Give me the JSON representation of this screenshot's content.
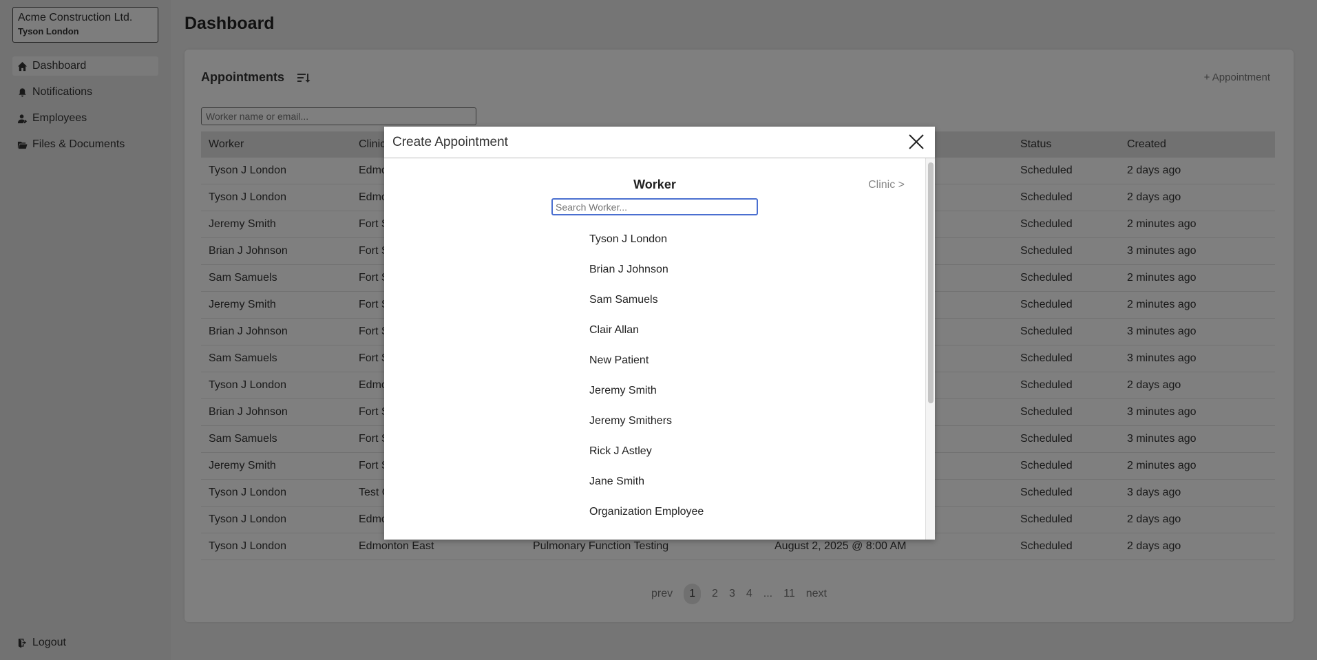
{
  "sidebar": {
    "org_name": "Acme Construction Ltd.",
    "user_name": "Tyson London",
    "items": [
      {
        "label": "Dashboard",
        "icon": "home-icon"
      },
      {
        "label": "Notifications",
        "icon": "bell-icon"
      },
      {
        "label": "Employees",
        "icon": "user-icon"
      },
      {
        "label": "Files & Documents",
        "icon": "files-icon"
      }
    ],
    "logout_label": "Logout"
  },
  "page": {
    "title": "Dashboard"
  },
  "appointments": {
    "title": "Appointments",
    "add_label": "+ Appointment",
    "search_placeholder": "Worker name or email...",
    "columns": [
      "Worker",
      "Clinic",
      "",
      "",
      "Status",
      "Created"
    ],
    "rows": [
      {
        "worker": "Tyson J London",
        "clinic": "Edmo",
        "status": "Scheduled",
        "created": "2 days ago"
      },
      {
        "worker": "Tyson J London",
        "clinic": "Edmo",
        "status": "Scheduled",
        "created": "2 days ago"
      },
      {
        "worker": "Jeremy Smith",
        "clinic": "Fort S",
        "status": "Scheduled",
        "created": "2 minutes ago"
      },
      {
        "worker": "Brian J Johnson",
        "clinic": "Fort S",
        "status": "Scheduled",
        "created": "3 minutes ago"
      },
      {
        "worker": "Sam Samuels",
        "clinic": "Fort S",
        "status": "Scheduled",
        "created": "2 minutes ago"
      },
      {
        "worker": "Jeremy Smith",
        "clinic": "Fort S",
        "status": "Scheduled",
        "created": "2 minutes ago"
      },
      {
        "worker": "Brian J Johnson",
        "clinic": "Fort S",
        "status": "Scheduled",
        "created": "3 minutes ago"
      },
      {
        "worker": "Sam Samuels",
        "clinic": "Fort S",
        "status": "Scheduled",
        "created": "3 minutes ago"
      },
      {
        "worker": "Tyson J London",
        "clinic": "Edmo",
        "status": "Scheduled",
        "created": "2 days ago"
      },
      {
        "worker": "Brian J Johnson",
        "clinic": "Fort S",
        "status": "Scheduled",
        "created": "3 minutes ago"
      },
      {
        "worker": "Sam Samuels",
        "clinic": "Fort S",
        "status": "Scheduled",
        "created": "3 minutes ago"
      },
      {
        "worker": "Jeremy Smith",
        "clinic": "Fort S",
        "status": "Scheduled",
        "created": "2 minutes ago"
      },
      {
        "worker": "Tyson J London",
        "clinic": "Test C",
        "status": "Scheduled",
        "created": "3 days ago"
      },
      {
        "worker": "Tyson J London",
        "clinic": "Edmo",
        "status": "Scheduled",
        "created": "2 days ago"
      },
      {
        "worker": "Tyson J London",
        "clinic": "Edmonton East",
        "service": "Pulmonary Function Testing",
        "date": "August 2, 2025 @ 8:00 AM",
        "status": "Scheduled",
        "created": "2 days ago"
      }
    ],
    "pagination": {
      "prev": "prev",
      "pages": [
        "1",
        "2",
        "3",
        "4",
        "...",
        "11"
      ],
      "next": "next",
      "current": "1"
    }
  },
  "modal": {
    "title": "Create Appointment",
    "step_title": "Worker",
    "next_step": "Clinic >",
    "search_placeholder": "Search Worker...",
    "workers": [
      "Tyson J London",
      "Brian J Johnson",
      "Sam Samuels",
      "Clair Allan",
      "New Patient",
      "Jeremy Smith",
      "Jeremy Smithers",
      "Rick J Astley",
      "Jane Smith",
      "Organization Employee"
    ]
  },
  "colors": {
    "accent": "#4a6fd0",
    "overlay": "#000000"
  }
}
